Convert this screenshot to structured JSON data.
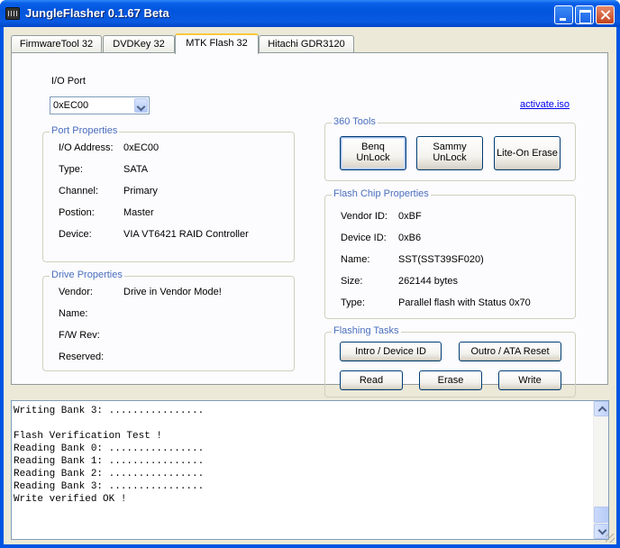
{
  "window": {
    "title": "JungleFlasher 0.1.67 Beta"
  },
  "tabs": [
    "FirmwareTool 32",
    "DVDKey 32",
    "MTK Flash 32",
    "Hitachi GDR3120"
  ],
  "io_port": {
    "label": "I/O Port",
    "value": "0xEC00"
  },
  "activate_link": "activate.iso",
  "port_properties": {
    "title": "Port Properties",
    "rows": [
      {
        "label": "I/O Address:",
        "value": "0xEC00"
      },
      {
        "label": "Type:",
        "value": "SATA"
      },
      {
        "label": "Channel:",
        "value": "Primary"
      },
      {
        "label": "Postion:",
        "value": "Master"
      },
      {
        "label": "Device:",
        "value": "VIA VT6421 RAID Controller"
      }
    ]
  },
  "drive_properties": {
    "title": "Drive Properties",
    "rows": [
      {
        "label": "Vendor:",
        "value": "Drive in Vendor Mode!"
      },
      {
        "label": "Name:",
        "value": ""
      },
      {
        "label": "F/W Rev:",
        "value": ""
      },
      {
        "label": "Reserved:",
        "value": ""
      }
    ]
  },
  "tools_360": {
    "title": "360 Tools",
    "buttons": [
      {
        "line1": "Benq",
        "line2": "UnLock"
      },
      {
        "line1": "Sammy",
        "line2": "UnLock"
      },
      {
        "line1": "Lite-On Erase",
        "line2": ""
      }
    ]
  },
  "flash_chip": {
    "title": "Flash Chip Properties",
    "rows": [
      {
        "label": "Vendor ID:",
        "value": "0xBF"
      },
      {
        "label": "Device ID:",
        "value": "0xB6"
      },
      {
        "label": "Name:",
        "value": "SST(SST39SF020)"
      },
      {
        "label": "Size:",
        "value": "262144 bytes"
      },
      {
        "label": "Type:",
        "value": "Parallel flash with Status 0x70"
      }
    ]
  },
  "flashing_tasks": {
    "title": "Flashing Tasks",
    "intro": "Intro / Device ID",
    "outro": "Outro / ATA Reset",
    "read": "Read",
    "erase": "Erase",
    "write": "Write"
  },
  "log": {
    "text": "Writing Bank 3: ................\n\nFlash Verification Test !\nReading Bank 0: ................\nReading Bank 1: ................\nReading Bank 2: ................\nReading Bank 3: ................\nWrite verified OK !"
  },
  "colors": {
    "title_bar": "#0054e3",
    "group_title": "#4a6ebd",
    "active_tab_accent": "#ffc83c",
    "face": "#ece9d8"
  }
}
